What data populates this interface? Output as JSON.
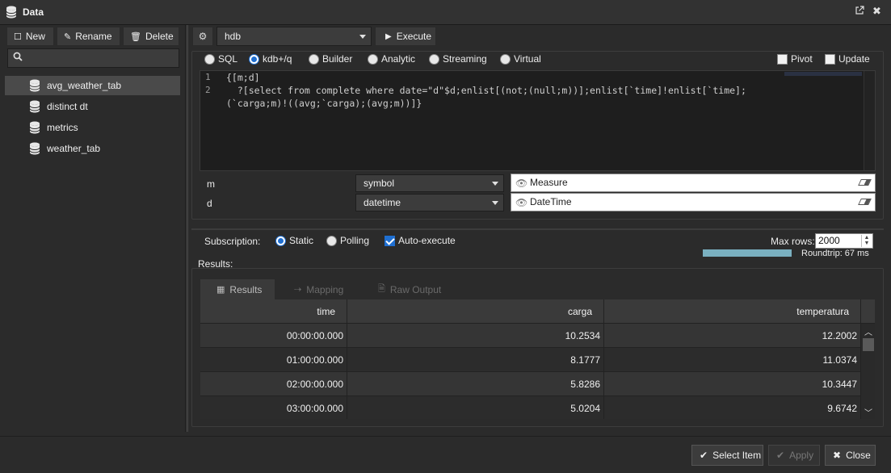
{
  "window": {
    "title": "Data",
    "icons": [
      "database-icon",
      "popout-icon",
      "close-icon"
    ]
  },
  "left": {
    "toolbar": {
      "new_label": "New",
      "rename_label": "Rename",
      "delete_label": "Delete"
    },
    "search": {
      "value": "",
      "placeholder": ""
    },
    "tree": [
      {
        "label": "avg_weather_tab",
        "selected": true
      },
      {
        "label": "distinct dt",
        "selected": false
      },
      {
        "label": "metrics",
        "selected": false
      },
      {
        "label": "weather_tab",
        "selected": false
      }
    ]
  },
  "toolbar": {
    "connection": "hdb",
    "execute_label": "Execute"
  },
  "modes": {
    "options": [
      "SQL",
      "kdb+/q",
      "Builder",
      "Analytic",
      "Streaming",
      "Virtual"
    ],
    "selected": "kdb+/q",
    "pivot_label": "Pivot",
    "pivot_checked": false,
    "update_label": "Update",
    "update_checked": false
  },
  "editor": {
    "line_numbers": [
      "1",
      "2"
    ],
    "lines": [
      "{[m;d]",
      "  ?[select from complete where date=\"d\"$d;enlist[(not;(null;m))];enlist[`time]!enlist[`time];",
      "(`carga;m)!((avg;`carga);(avg;m))]}"
    ]
  },
  "params": [
    {
      "name": "m",
      "type": "symbol",
      "value": "Measure"
    },
    {
      "name": "d",
      "type": "datetime",
      "value": "DateTime"
    }
  ],
  "subscription": {
    "label": "Subscription:",
    "static_label": "Static",
    "polling_label": "Polling",
    "selected": "Static",
    "auto_execute_label": "Auto-execute",
    "auto_execute": true,
    "max_rows_label": "Max rows:",
    "max_rows": "2000",
    "roundtrip": "Roundtrip: 67 ms"
  },
  "results": {
    "label": "Results:",
    "tabs": [
      "Results",
      "Mapping",
      "Raw Output"
    ],
    "active_tab": "Results",
    "columns": [
      "time",
      "carga",
      "temperatura"
    ],
    "rows": [
      [
        "00:00:00.000",
        "10.2534",
        "12.2002"
      ],
      [
        "01:00:00.000",
        "8.1777",
        "11.0374"
      ],
      [
        "02:00:00.000",
        "5.8286",
        "10.3447"
      ],
      [
        "03:00:00.000",
        "5.0204",
        "9.6742"
      ]
    ]
  },
  "footer": {
    "select_label": "Select Item",
    "apply_label": "Apply",
    "close_label": "Close"
  }
}
